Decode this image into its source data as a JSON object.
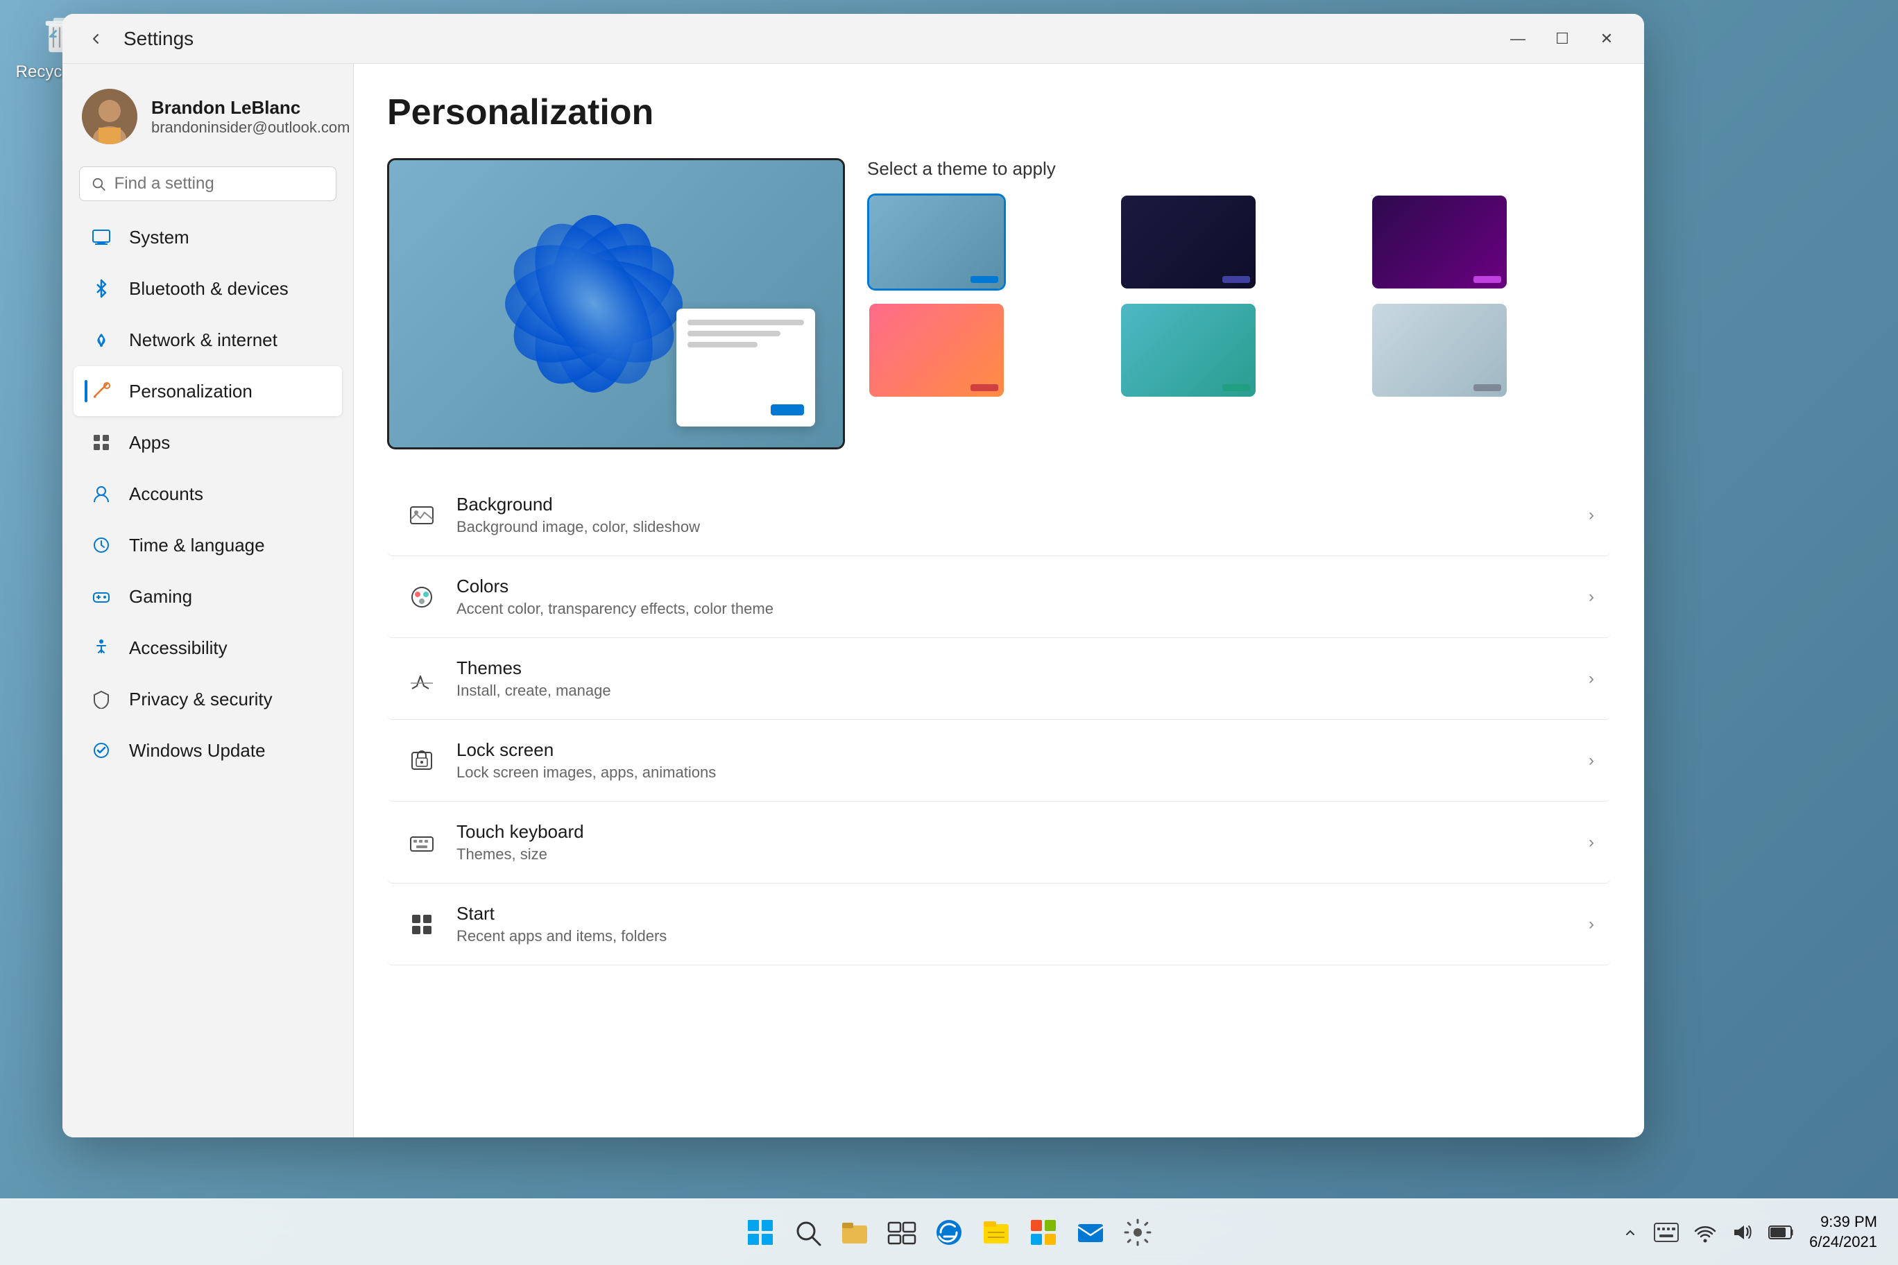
{
  "desktop": {
    "recycle_bin": {
      "label": "Recycle Bin"
    }
  },
  "taskbar": {
    "clock": {
      "time": "9:39 PM",
      "date": "6/24/2021"
    }
  },
  "window": {
    "title": "Settings",
    "back_label": "←",
    "minimize_label": "—",
    "maximize_label": "☐",
    "close_label": "✕"
  },
  "user": {
    "name": "Brandon LeBlanc",
    "email": "brandoninsider@outlook.com"
  },
  "search": {
    "placeholder": "Find a setting"
  },
  "nav": {
    "items": [
      {
        "id": "system",
        "label": "System",
        "color": "#0078d4"
      },
      {
        "id": "bluetooth",
        "label": "Bluetooth & devices",
        "color": "#0078d4"
      },
      {
        "id": "network",
        "label": "Network & internet",
        "color": "#0078d4"
      },
      {
        "id": "personalization",
        "label": "Personalization",
        "color": "#e8752a",
        "active": true
      },
      {
        "id": "apps",
        "label": "Apps",
        "color": "#555"
      },
      {
        "id": "accounts",
        "label": "Accounts",
        "color": "#0078d4"
      },
      {
        "id": "time",
        "label": "Time & language",
        "color": "#0078d4"
      },
      {
        "id": "gaming",
        "label": "Gaming",
        "color": "#0078d4"
      },
      {
        "id": "accessibility",
        "label": "Accessibility",
        "color": "#0078d4"
      },
      {
        "id": "privacy",
        "label": "Privacy & security",
        "color": "#555"
      },
      {
        "id": "update",
        "label": "Windows Update",
        "color": "#0078d4"
      }
    ]
  },
  "main": {
    "title": "Personalization",
    "theme_section_title": "Select a theme to apply",
    "settings_items": [
      {
        "id": "background",
        "title": "Background",
        "subtitle": "Background image, color, slideshow"
      },
      {
        "id": "colors",
        "title": "Colors",
        "subtitle": "Accent color, transparency effects, color theme"
      },
      {
        "id": "themes",
        "title": "Themes",
        "subtitle": "Install, create, manage"
      },
      {
        "id": "lock-screen",
        "title": "Lock screen",
        "subtitle": "Lock screen images, apps, animations"
      },
      {
        "id": "touch-keyboard",
        "title": "Touch keyboard",
        "subtitle": "Themes, size"
      },
      {
        "id": "start",
        "title": "Start",
        "subtitle": "Recent apps and items, folders"
      }
    ]
  }
}
